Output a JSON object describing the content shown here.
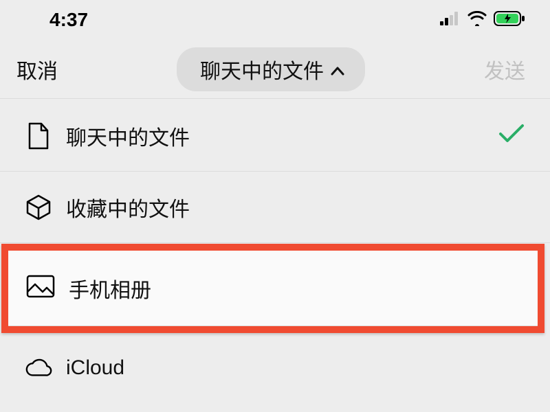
{
  "statusBar": {
    "time": "4:37"
  },
  "navBar": {
    "cancel": "取消",
    "title": "聊天中的文件",
    "send": "发送"
  },
  "options": {
    "chatFiles": "聊天中的文件",
    "favoriteFiles": "收藏中的文件",
    "phoneAlbum": "手机相册",
    "icloud": "iCloud"
  }
}
